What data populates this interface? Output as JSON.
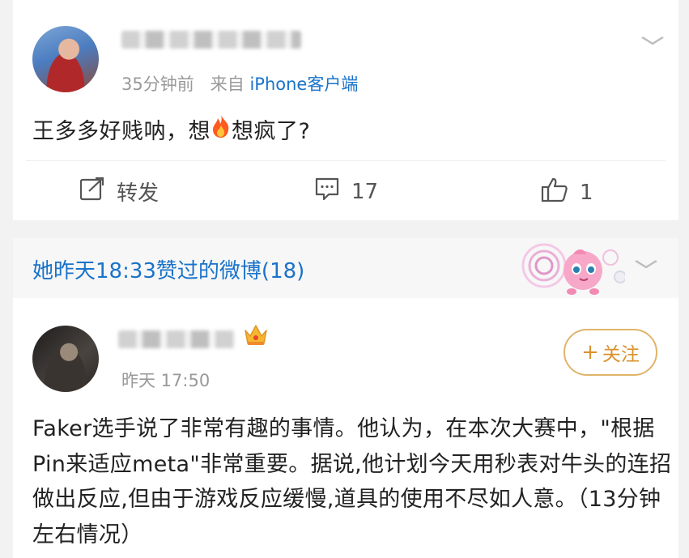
{
  "post": {
    "time": "35分钟前",
    "from_label": "来自",
    "source": "iPhone客户端",
    "text_before": "王多多好贱呐，想",
    "emoji": "fire",
    "text_after": "想疯了?",
    "actions": {
      "repost_label": "转发",
      "comment_count": "17",
      "like_count": "1"
    }
  },
  "liked_section": {
    "title": "她昨天18:33赞过的微博(18)"
  },
  "liked_post": {
    "time": "昨天 17:50",
    "follow_label": "关注",
    "text": "Faker选手说了非常有趣的事情。他认为，在本次大赛中，\"根据Pin来适应meta\"非常重要。据说,他计划今天用秒表对牛头的连招做出反应,但由于游戏反应缓慢,道具的使用不尽如人意。（13分钟左右情况）"
  },
  "colors": {
    "link_blue": "#1a73c9",
    "follow_gold": "#d9922c"
  },
  "icons": [
    "chevron-down-icon",
    "repost-icon",
    "comment-icon",
    "like-icon",
    "crown-icon",
    "plus-icon"
  ]
}
